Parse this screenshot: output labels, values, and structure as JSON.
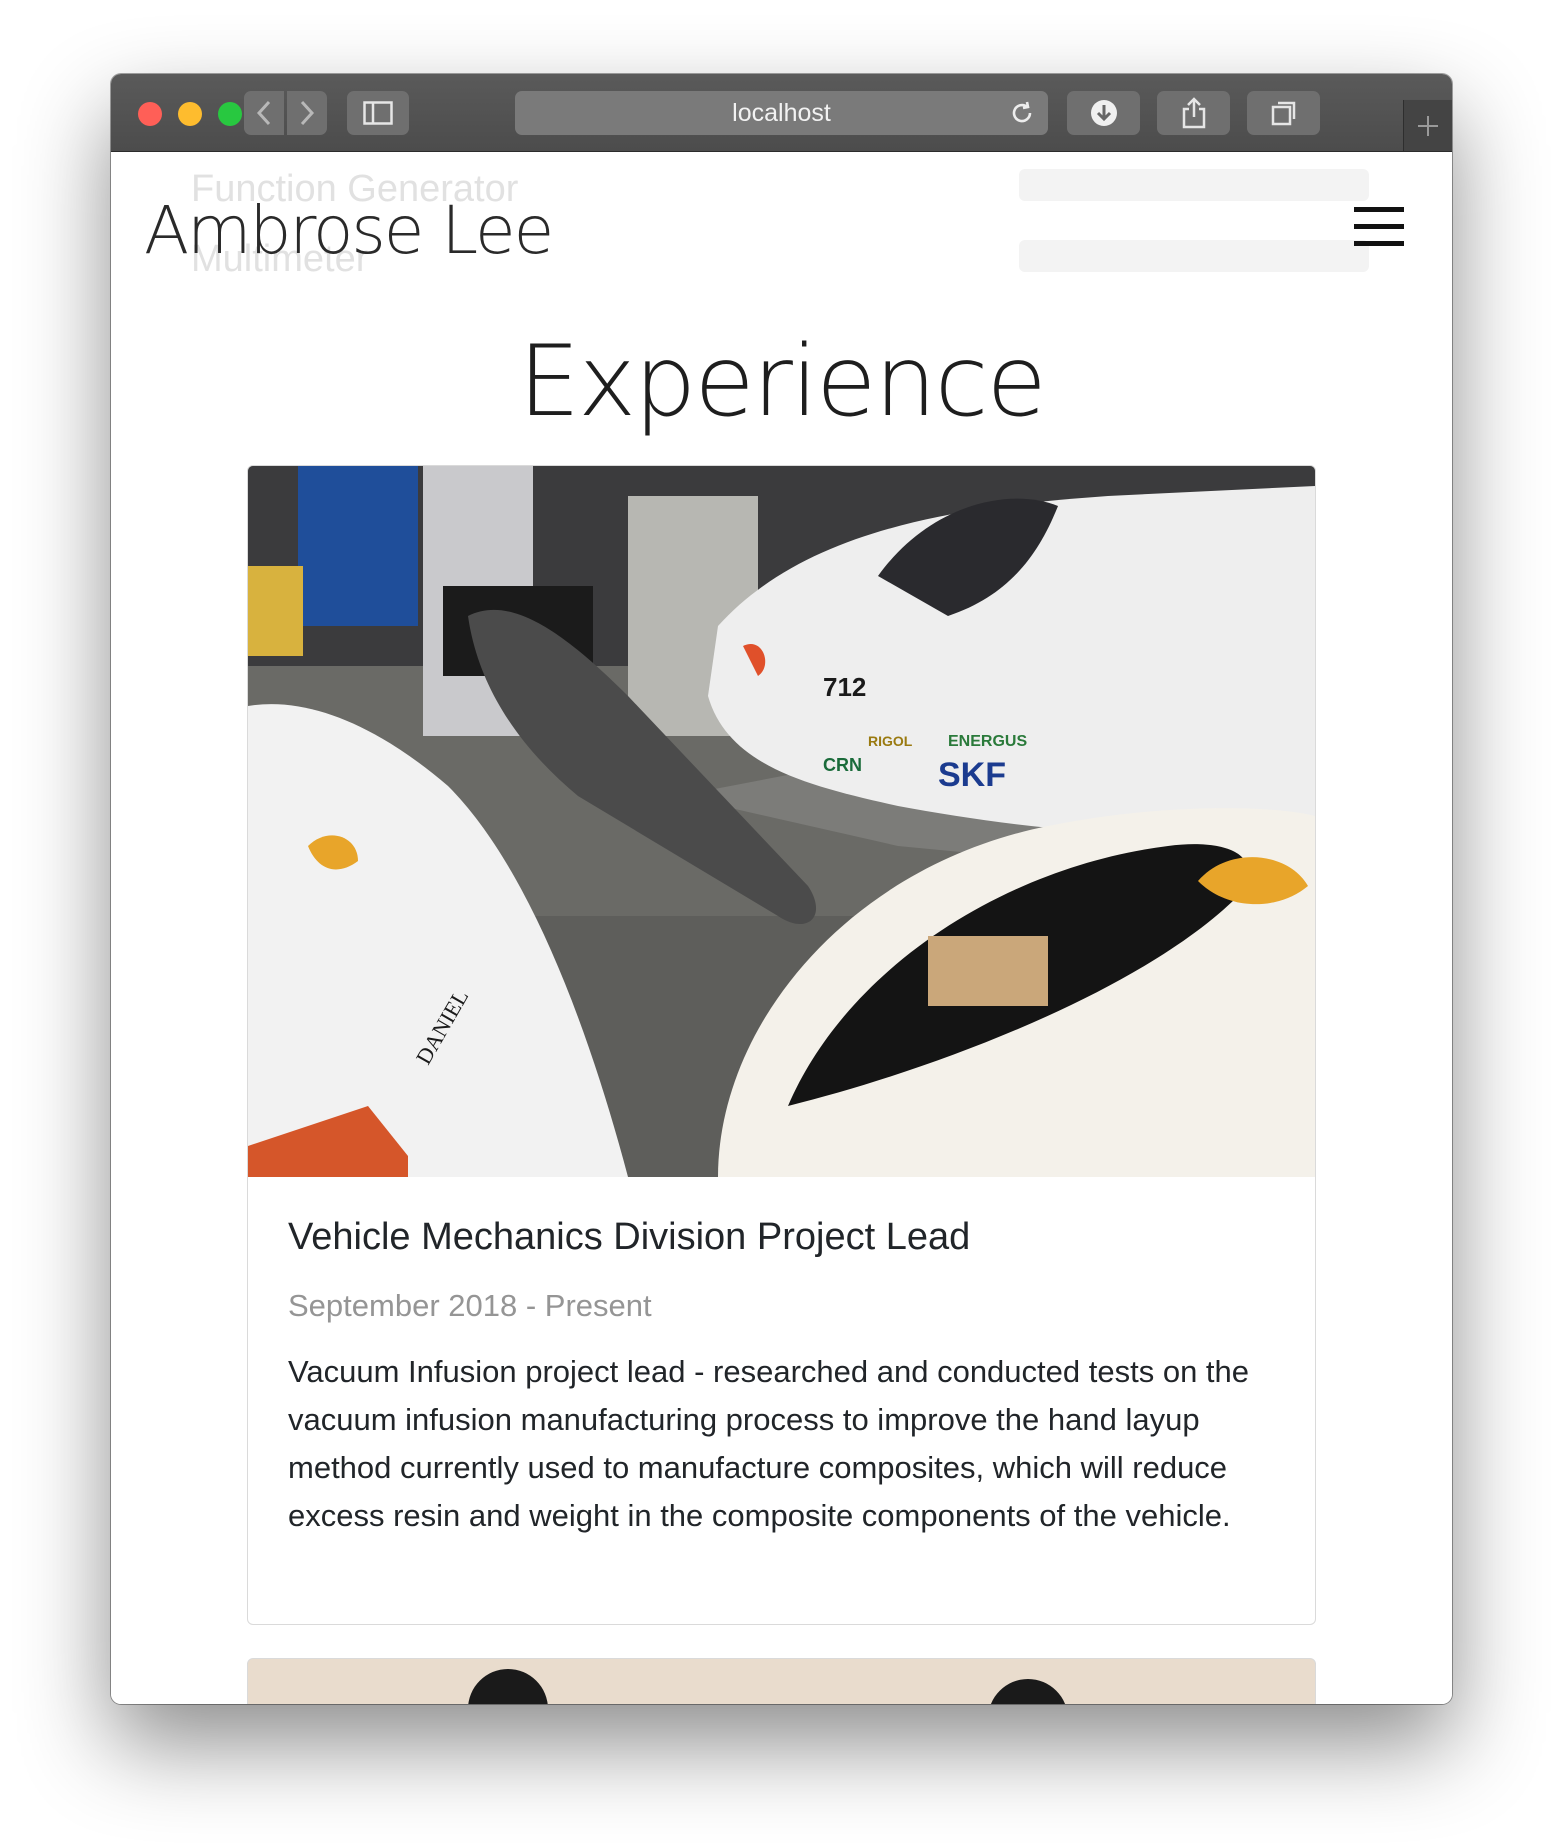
{
  "browser": {
    "url": "localhost"
  },
  "ghost_text": {
    "line1": "Function Generator",
    "line2": "Multimeter"
  },
  "brand": {
    "name": "Ambrose Lee"
  },
  "section": {
    "title": "Experience"
  },
  "experience": [
    {
      "title": "Vehicle Mechanics Division Project Lead",
      "date": "September 2018 - Present",
      "description": "Vacuum Infusion project lead - researched and conducted tests on the vacuum infusion manufacturing process to improve the hand layup method currently used to manufacture composites, which will reduce excess resin and weight in the composite components of the vehicle.",
      "image_stickers": [
        "712",
        "SKF",
        "CRN",
        "ENERGUS",
        "RIGOL",
        "DANIEL"
      ]
    }
  ],
  "colors": {
    "titlebar": "#4c4c4c",
    "traffic_red": "#ff5f57",
    "traffic_yellow": "#febc2e",
    "traffic_green": "#28c840",
    "text": "#212529",
    "muted": "#959595"
  },
  "icons": [
    "back-icon",
    "forward-icon",
    "sidebar-icon",
    "reload-icon",
    "download-icon",
    "share-icon",
    "tabs-icon",
    "plus-icon",
    "hamburger-menu-icon"
  ]
}
